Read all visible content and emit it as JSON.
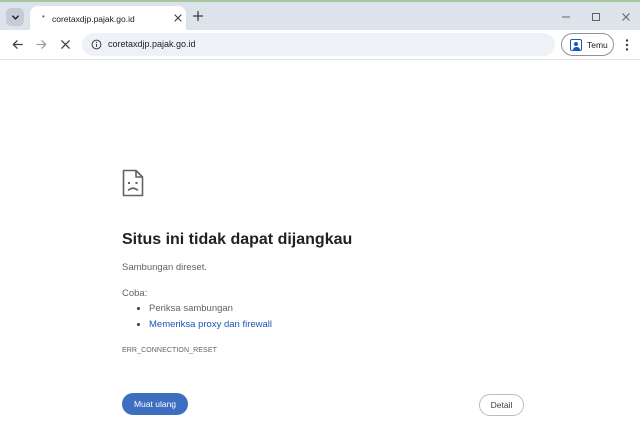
{
  "browser": {
    "tab": {
      "title": "coretaxdjp.pajak.go.id",
      "favicon": "loading-dot-icon"
    },
    "address_bar": {
      "url": "coretaxdjp.pajak.go.id"
    },
    "profile_button": {
      "label": "Temu"
    }
  },
  "error_page": {
    "icon": "sad-page-icon",
    "title": "Situs ini tidak dapat dijangkau",
    "description": "Sambungan direset.",
    "try_label": "Coba:",
    "suggestions": [
      {
        "text": "Periksa sambungan",
        "is_link": false
      },
      {
        "text": "Memeriksa proxy dan firewall",
        "is_link": true
      }
    ],
    "error_code": "ERR_CONNECTION_RESET",
    "reload_button": "Muat ulang",
    "details_button": "Detail"
  },
  "colors": {
    "primary_button": "#3d6ec0",
    "link": "#1a56b8",
    "tabstrip": "#dde3ea",
    "omnibox": "#eef2f7"
  }
}
